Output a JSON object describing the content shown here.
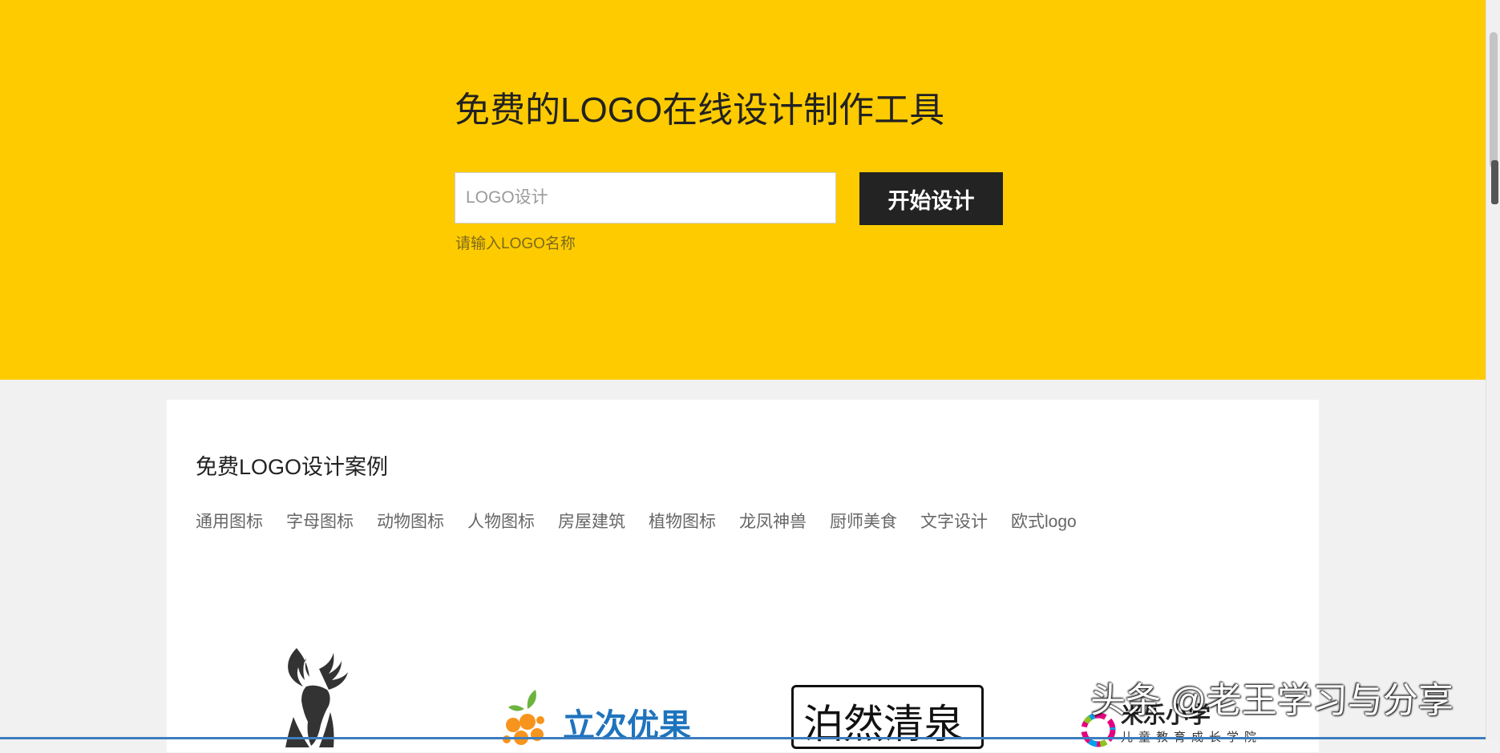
{
  "hero": {
    "title": "免费的LOGO在线设计制作工具",
    "input_placeholder": "LOGO设计",
    "start_button": "开始设计",
    "hint": "请输入LOGO名称"
  },
  "gallery": {
    "title": "免费LOGO设计案例",
    "categories": [
      "通用图标",
      "字母图标",
      "动物图标",
      "人物图标",
      "房屋建筑",
      "植物图标",
      "龙凤神兽",
      "厨师美食",
      "文字设计",
      "欧式logo"
    ],
    "logos": {
      "fruit_text": "立次优果",
      "spring_text": "泊然清泉",
      "edu_name": "米乐小学",
      "edu_sub": "儿童教育成长学院"
    }
  },
  "watermark": "头条 @老王学习与分享",
  "colors": {
    "hero_bg": "#fecb00",
    "button_bg": "#232323",
    "page_bg": "#f1f1f1"
  }
}
